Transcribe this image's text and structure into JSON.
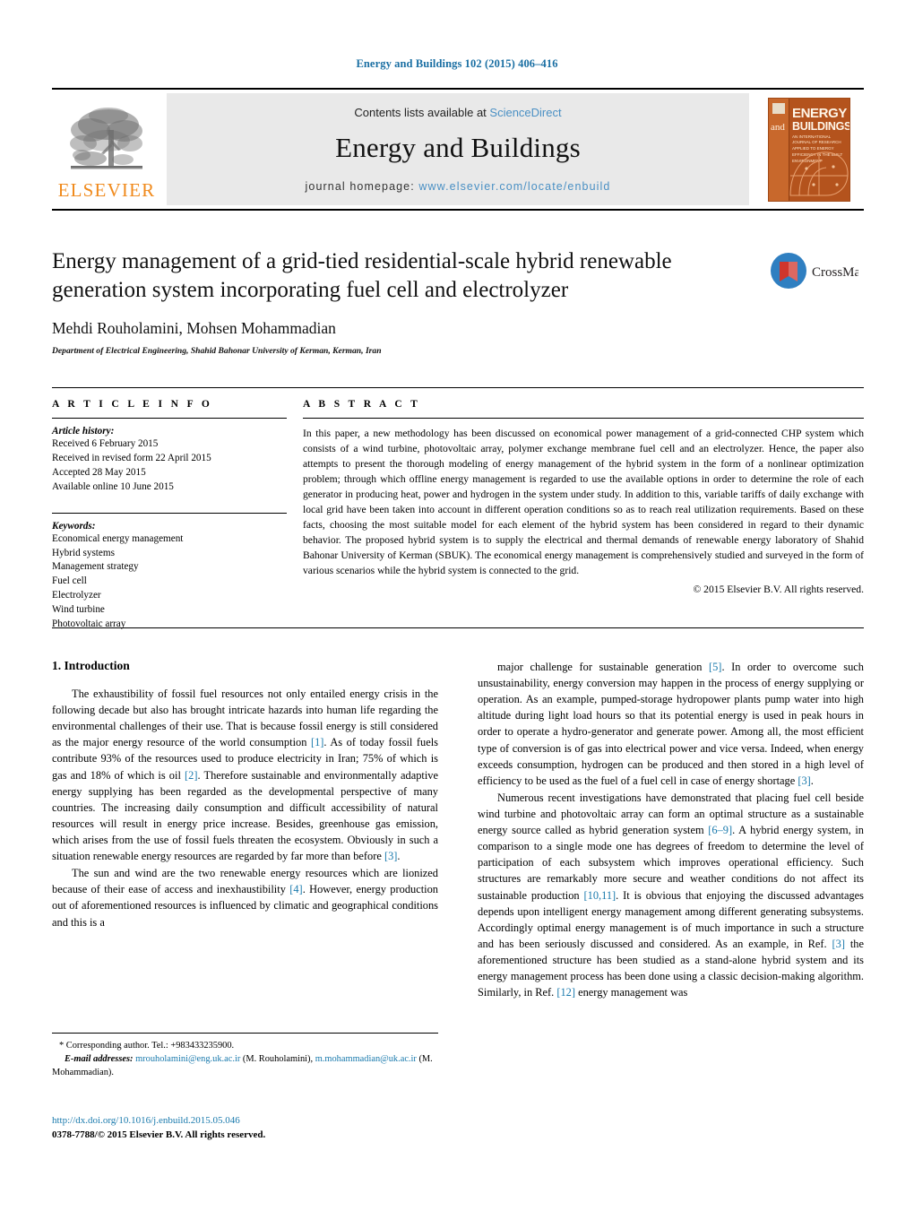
{
  "running_head": "Energy and Buildings 102 (2015) 406–416",
  "masthead": {
    "publisher_logo_text": "ELSEVIER",
    "contents_prefix": "Contents lists available at ",
    "contents_link": "ScienceDirect",
    "journal_name": "Energy and Buildings",
    "homepage_label": "journal homepage:",
    "homepage_url": "www.elsevier.com/locate/enbuild",
    "cover": {
      "line1": "ENERGY",
      "and": "and",
      "line2": "BUILDINGS",
      "subtitle": "AN INTERNATIONAL JOURNAL OF RESEARCH APPLIED TO ENERGY EFFICIENCY IN THE BUILT ENVIRONMENT"
    }
  },
  "article": {
    "title": "Energy management of a grid-tied residential-scale hybrid renewable generation system incorporating fuel cell and electrolyzer",
    "authors": "Mehdi Rouholamini, Mohsen Mohammadian",
    "author_marker": "*",
    "affiliation": "Department of Electrical Engineering, Shahid Bahonar University of Kerman, Kerman, Iran",
    "crossmark_label": "CrossMark"
  },
  "info": {
    "section_label": "A R T I C L E   I N F O",
    "history_title": "Article history:",
    "history": [
      "Received 6 February 2015",
      "Received in revised form 22 April 2015",
      "Accepted 28 May 2015",
      "Available online 10 June 2015"
    ],
    "keywords_title": "Keywords:",
    "keywords": [
      "Economical energy management",
      "Hybrid systems",
      "Management strategy",
      "Fuel cell",
      "Electrolyzer",
      "Wind turbine",
      "Photovoltaic array"
    ]
  },
  "abstract": {
    "section_label": "A B S T R A C T",
    "text": "In this paper, a new methodology has been discussed on economical power management of a grid-connected CHP system which consists of a wind turbine, photovoltaic array, polymer exchange membrane fuel cell and an electrolyzer. Hence, the paper also attempts to present the thorough modeling of energy management of the hybrid system in the form of a nonlinear optimization problem; through which offline energy management is regarded to use the available options in order to determine the role of each generator in producing heat, power and hydrogen in the system under study. In addition to this, variable tariffs of daily exchange with local grid have been taken into account in different operation conditions so as to reach real utilization requirements. Based on these facts, choosing the most suitable model for each element of the hybrid system has been considered in regard to their dynamic behavior. The proposed hybrid system is to supply the electrical and thermal demands of renewable energy laboratory of Shahid Bahonar University of Kerman (SBUK). The economical energy management is comprehensively studied and surveyed in the form of various scenarios while the hybrid system is connected to the grid.",
    "copyright": "© 2015 Elsevier B.V. All rights reserved."
  },
  "body": {
    "section_heading": "1.  Introduction",
    "left_paragraphs": [
      "The exhaustibility of fossil fuel resources not only entailed energy crisis in the following decade but also has brought intricate hazards into human life regarding the environmental challenges of their use. That is because fossil energy is still considered as the major energy resource of the world consumption [1]. As of today fossil fuels contribute 93% of the resources used to produce electricity in Iran; 75% of which is gas and 18% of which is oil [2]. Therefore sustainable and environmentally adaptive energy supplying has been regarded as the developmental perspective of many countries. The increasing daily consumption and difficult accessibility of natural resources will result in energy price increase. Besides, greenhouse gas emission, which arises from the use of fossil fuels threaten the ecosystem. Obviously in such a situation renewable energy resources are regarded by far more than before [3].",
      "The sun and wind are the two renewable energy resources which are lionized because of their ease of access and inexhaustibility [4]. However, energy production out of aforementioned resources is influenced by climatic and geographical conditions and this is a"
    ],
    "right_paragraphs": [
      "major challenge for sustainable generation [5]. In order to overcome such unsustainability, energy conversion may happen in the process of energy supplying or operation. As an example, pumped-storage hydropower plants pump water into high altitude during light load hours so that its potential energy is used in peak hours in order to operate a hydro-generator and generate power. Among all, the most efficient type of conversion is of gas into electrical power and vice versa. Indeed, when energy exceeds consumption, hydrogen can be produced and then stored in a high level of efficiency to be used as the fuel of a fuel cell in case of energy shortage [3].",
      "Numerous recent investigations have demonstrated that placing fuel cell beside wind turbine and photovoltaic array can form an optimal structure as a sustainable energy source called as hybrid generation system [6–9]. A hybrid energy system, in comparison to a single mode one has degrees of freedom to determine the level of participation of each subsystem which improves operational efficiency. Such structures are remarkably more secure and weather conditions do not affect its sustainable production [10,11]. It is obvious that enjoying the discussed advantages depends upon intelligent energy management among different generating subsystems. Accordingly optimal energy management is of much importance in such a structure and has been seriously discussed and considered. As an example, in Ref. [3] the aforementioned structure has been studied as a stand-alone hybrid system and its energy management process has been done using a classic decision-making algorithm. Similarly, in Ref. [12] energy management was"
    ]
  },
  "footnotes": {
    "corresponding": "* Corresponding author. Tel.: +983433235900.",
    "email_label": "E-mail addresses:",
    "email1": "mrouholamini@eng.uk.ac.ir",
    "email1_name": " (M. Rouholamini),",
    "email2": "m.mohammadian@uk.ac.ir",
    "email2_name": " (M. Mohammadian)."
  },
  "footer": {
    "doi": "http://dx.doi.org/10.1016/j.enbuild.2015.05.046",
    "issn": "0378-7788/© 2015 Elsevier B.V. All rights reserved."
  },
  "colors": {
    "link_blue": "#1a7aad",
    "science_direct_blue": "#4a90c4",
    "elsevier_orange": "#f08a1c",
    "cover_brown": "#b4531d"
  }
}
